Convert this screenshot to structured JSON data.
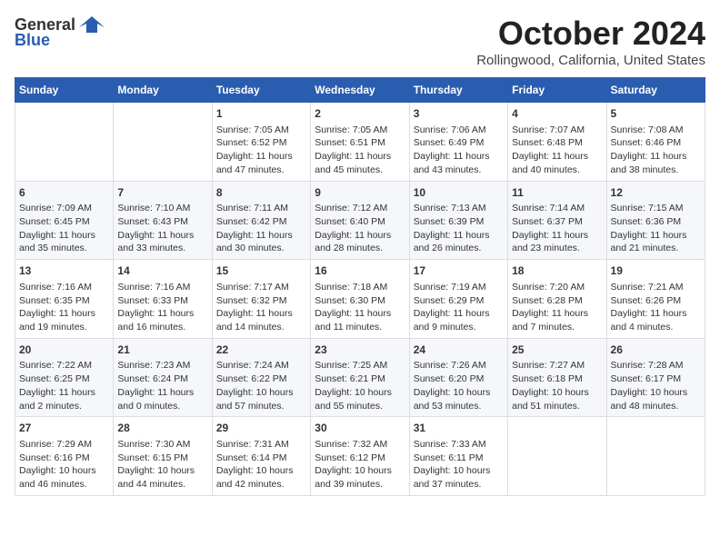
{
  "header": {
    "logo_general": "General",
    "logo_blue": "Blue",
    "month_title": "October 2024",
    "location": "Rollingwood, California, United States"
  },
  "columns": [
    "Sunday",
    "Monday",
    "Tuesday",
    "Wednesday",
    "Thursday",
    "Friday",
    "Saturday"
  ],
  "weeks": [
    [
      {
        "day": "",
        "info": ""
      },
      {
        "day": "",
        "info": ""
      },
      {
        "day": "1",
        "info": "Sunrise: 7:05 AM\nSunset: 6:52 PM\nDaylight: 11 hours and 47 minutes."
      },
      {
        "day": "2",
        "info": "Sunrise: 7:05 AM\nSunset: 6:51 PM\nDaylight: 11 hours and 45 minutes."
      },
      {
        "day": "3",
        "info": "Sunrise: 7:06 AM\nSunset: 6:49 PM\nDaylight: 11 hours and 43 minutes."
      },
      {
        "day": "4",
        "info": "Sunrise: 7:07 AM\nSunset: 6:48 PM\nDaylight: 11 hours and 40 minutes."
      },
      {
        "day": "5",
        "info": "Sunrise: 7:08 AM\nSunset: 6:46 PM\nDaylight: 11 hours and 38 minutes."
      }
    ],
    [
      {
        "day": "6",
        "info": "Sunrise: 7:09 AM\nSunset: 6:45 PM\nDaylight: 11 hours and 35 minutes."
      },
      {
        "day": "7",
        "info": "Sunrise: 7:10 AM\nSunset: 6:43 PM\nDaylight: 11 hours and 33 minutes."
      },
      {
        "day": "8",
        "info": "Sunrise: 7:11 AM\nSunset: 6:42 PM\nDaylight: 11 hours and 30 minutes."
      },
      {
        "day": "9",
        "info": "Sunrise: 7:12 AM\nSunset: 6:40 PM\nDaylight: 11 hours and 28 minutes."
      },
      {
        "day": "10",
        "info": "Sunrise: 7:13 AM\nSunset: 6:39 PM\nDaylight: 11 hours and 26 minutes."
      },
      {
        "day": "11",
        "info": "Sunrise: 7:14 AM\nSunset: 6:37 PM\nDaylight: 11 hours and 23 minutes."
      },
      {
        "day": "12",
        "info": "Sunrise: 7:15 AM\nSunset: 6:36 PM\nDaylight: 11 hours and 21 minutes."
      }
    ],
    [
      {
        "day": "13",
        "info": "Sunrise: 7:16 AM\nSunset: 6:35 PM\nDaylight: 11 hours and 19 minutes."
      },
      {
        "day": "14",
        "info": "Sunrise: 7:16 AM\nSunset: 6:33 PM\nDaylight: 11 hours and 16 minutes."
      },
      {
        "day": "15",
        "info": "Sunrise: 7:17 AM\nSunset: 6:32 PM\nDaylight: 11 hours and 14 minutes."
      },
      {
        "day": "16",
        "info": "Sunrise: 7:18 AM\nSunset: 6:30 PM\nDaylight: 11 hours and 11 minutes."
      },
      {
        "day": "17",
        "info": "Sunrise: 7:19 AM\nSunset: 6:29 PM\nDaylight: 11 hours and 9 minutes."
      },
      {
        "day": "18",
        "info": "Sunrise: 7:20 AM\nSunset: 6:28 PM\nDaylight: 11 hours and 7 minutes."
      },
      {
        "day": "19",
        "info": "Sunrise: 7:21 AM\nSunset: 6:26 PM\nDaylight: 11 hours and 4 minutes."
      }
    ],
    [
      {
        "day": "20",
        "info": "Sunrise: 7:22 AM\nSunset: 6:25 PM\nDaylight: 11 hours and 2 minutes."
      },
      {
        "day": "21",
        "info": "Sunrise: 7:23 AM\nSunset: 6:24 PM\nDaylight: 11 hours and 0 minutes."
      },
      {
        "day": "22",
        "info": "Sunrise: 7:24 AM\nSunset: 6:22 PM\nDaylight: 10 hours and 57 minutes."
      },
      {
        "day": "23",
        "info": "Sunrise: 7:25 AM\nSunset: 6:21 PM\nDaylight: 10 hours and 55 minutes."
      },
      {
        "day": "24",
        "info": "Sunrise: 7:26 AM\nSunset: 6:20 PM\nDaylight: 10 hours and 53 minutes."
      },
      {
        "day": "25",
        "info": "Sunrise: 7:27 AM\nSunset: 6:18 PM\nDaylight: 10 hours and 51 minutes."
      },
      {
        "day": "26",
        "info": "Sunrise: 7:28 AM\nSunset: 6:17 PM\nDaylight: 10 hours and 48 minutes."
      }
    ],
    [
      {
        "day": "27",
        "info": "Sunrise: 7:29 AM\nSunset: 6:16 PM\nDaylight: 10 hours and 46 minutes."
      },
      {
        "day": "28",
        "info": "Sunrise: 7:30 AM\nSunset: 6:15 PM\nDaylight: 10 hours and 44 minutes."
      },
      {
        "day": "29",
        "info": "Sunrise: 7:31 AM\nSunset: 6:14 PM\nDaylight: 10 hours and 42 minutes."
      },
      {
        "day": "30",
        "info": "Sunrise: 7:32 AM\nSunset: 6:12 PM\nDaylight: 10 hours and 39 minutes."
      },
      {
        "day": "31",
        "info": "Sunrise: 7:33 AM\nSunset: 6:11 PM\nDaylight: 10 hours and 37 minutes."
      },
      {
        "day": "",
        "info": ""
      },
      {
        "day": "",
        "info": ""
      }
    ]
  ]
}
